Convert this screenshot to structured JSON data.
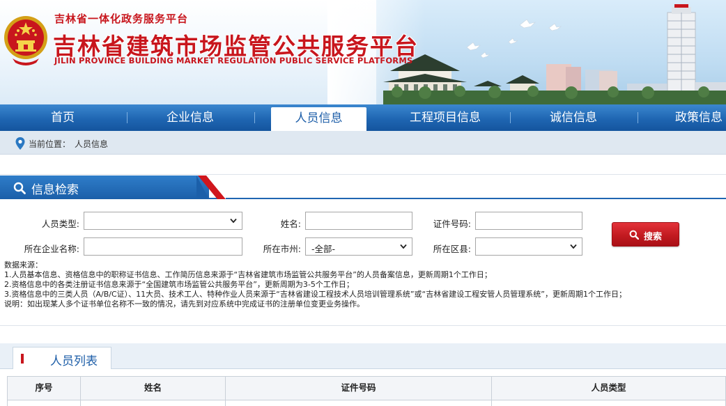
{
  "header": {
    "top_subtitle": "吉林省一体化政务服务平台",
    "title": "吉林省建筑市场监管公共服务平台",
    "title_en": "JILIN PROVINCE BUILDING MARKET REGULATION PUBLIC SERVICE PLATFORMS",
    "emblem_icon": "national-emblem-icon"
  },
  "nav": {
    "items": [
      {
        "label": "首页",
        "active": false
      },
      {
        "label": "企业信息",
        "active": false
      },
      {
        "label": "人员信息",
        "active": true
      },
      {
        "label": "工程项目信息",
        "active": false
      },
      {
        "label": "诚信信息",
        "active": false
      },
      {
        "label": "政策信息",
        "active": false
      }
    ]
  },
  "breadcrumb": {
    "label": "当前位置：",
    "current": "人员信息",
    "icon": "location-pin-icon"
  },
  "search": {
    "title": "信息检索",
    "icon": "search-icon",
    "fields": {
      "person_type": {
        "label": "人员类型:",
        "value": ""
      },
      "name": {
        "label": "姓名:",
        "value": ""
      },
      "cert_no": {
        "label": "证件号码:",
        "value": ""
      },
      "company": {
        "label": "所在企业名称:",
        "value": ""
      },
      "city": {
        "label": "所在市州:",
        "value": "-全部-"
      },
      "district": {
        "label": "所在区县:",
        "value": ""
      }
    },
    "button_label": "搜索"
  },
  "notes": [
    "数据来源：",
    "1.人员基本信息、资格信息中的职称证书信息、工作简历信息来源于“吉林省建筑市场监管公共服务平台”的人员备案信息，更新周期1个工作日；",
    "2.资格信息中的各类注册证书信息来源于“全国建筑市场监管公共服务平台”，更新周期为3-5个工作日；",
    "3.资格信息中的三类人员（A/B/C证）、11大员、技术工人、特种作业人员来源于“吉林省建设工程技术人员培训管理系统”或“吉林省建设工程安管人员管理系统”，更新周期1个工作日；",
    "说明：如出现某人多个证书单位名称不一致的情况，请先到对应系统中完成证书的注册单位变更业务操作。"
  ],
  "list": {
    "title": "人员列表",
    "columns": [
      "序号",
      "姓名",
      "证件号码",
      "人员类型"
    ]
  },
  "colors": {
    "brand_red": "#c8161d",
    "nav_blue": "#1f66b2",
    "active_text": "#1d5ea8"
  }
}
